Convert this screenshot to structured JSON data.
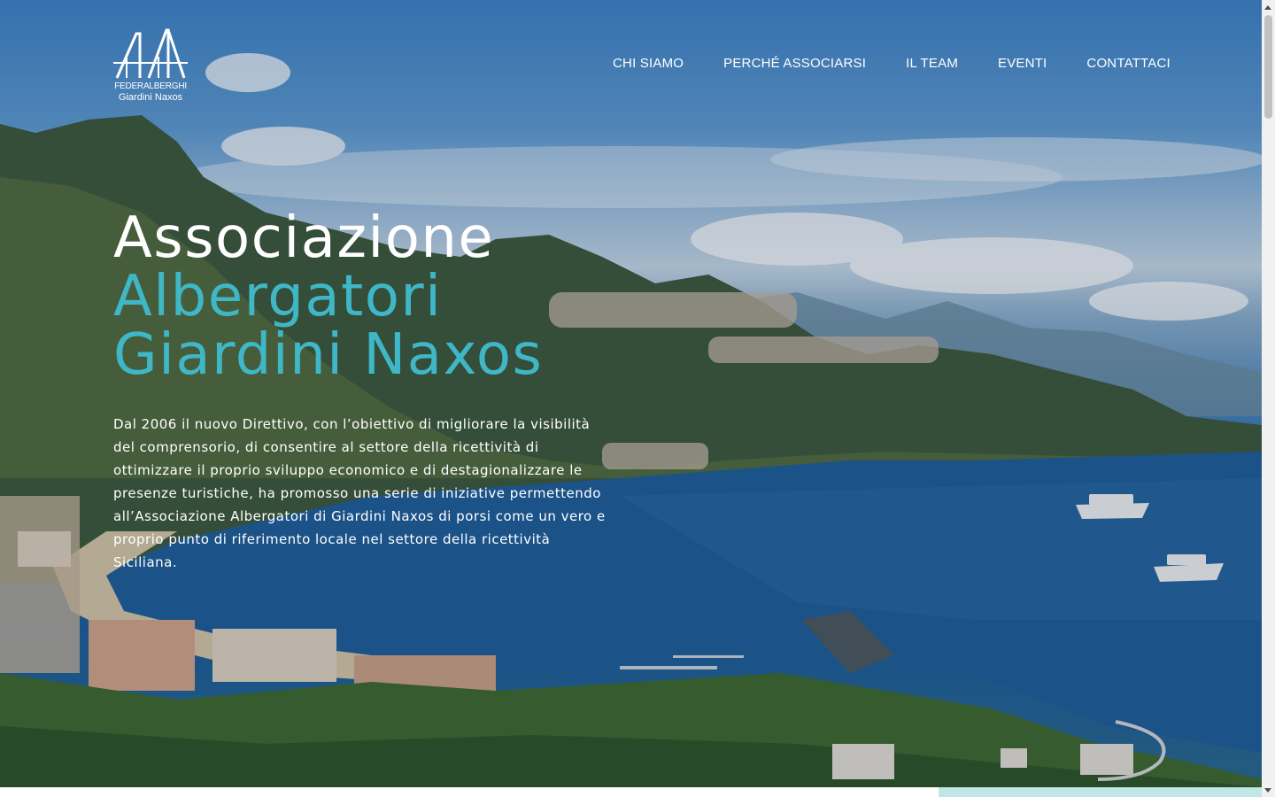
{
  "logo": {
    "line1": "FEDERALBERGHI",
    "line2": "Giardini Naxos"
  },
  "nav": {
    "items": [
      {
        "label": "CHI SIAMO"
      },
      {
        "label": "PERCHÉ ASSOCIARSI"
      },
      {
        "label": "IL TEAM"
      },
      {
        "label": "EVENTI"
      },
      {
        "label": "CONTATTACI"
      }
    ]
  },
  "hero": {
    "title_line1": "Associazione",
    "title_line2": "Albergatori",
    "title_line3": "Giardini Naxos",
    "description": "Dal 2006 il nuovo Direttivo, con l’obiettivo di migliorare la visibilità del comprensorio, di consentire al settore della ricettività di ottimizzare il proprio sviluppo economico e di destagionalizzare le presenze turistiche, ha promosso una serie di iniziative permettendo all’Associazione Albergatori di Giardini Naxos di porsi come un vero e proprio punto di riferimento locale nel settore della ricettività Siciliana."
  },
  "colors": {
    "accent": "#3fb7c7",
    "text": "#ffffff"
  }
}
